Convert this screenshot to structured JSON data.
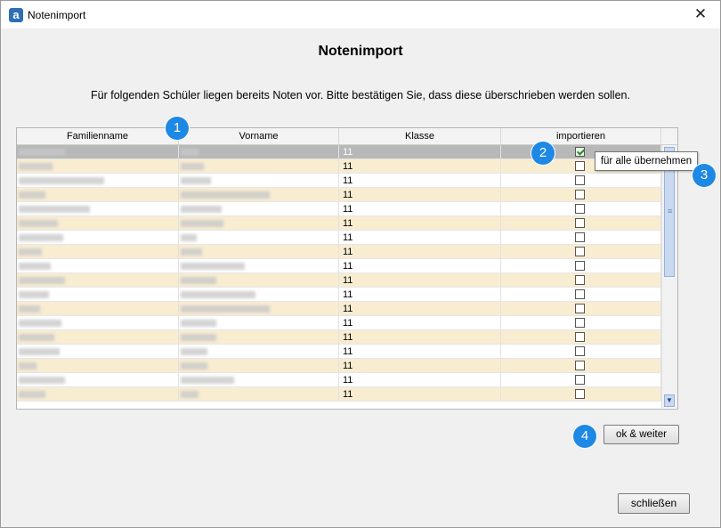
{
  "window": {
    "title": "Notenimport",
    "close_glyph": "✕",
    "app_logo": "a"
  },
  "dialog": {
    "heading": "Notenimport",
    "intro": "Für folgenden Schüler liegen bereits Noten vor. Bitte bestätigen Sie, dass diese überschrieben werden sollen."
  },
  "table": {
    "columns": [
      "Familienname",
      "Vorname",
      "Klasse",
      "importieren"
    ],
    "rows": [
      {
        "klasse": "11",
        "checked": true
      },
      {
        "klasse": "11",
        "checked": false
      },
      {
        "klasse": "11",
        "checked": false
      },
      {
        "klasse": "11",
        "checked": false
      },
      {
        "klasse": "11",
        "checked": false
      },
      {
        "klasse": "11",
        "checked": false
      },
      {
        "klasse": "11",
        "checked": false
      },
      {
        "klasse": "11",
        "checked": false
      },
      {
        "klasse": "11",
        "checked": false
      },
      {
        "klasse": "11",
        "checked": false
      },
      {
        "klasse": "11",
        "checked": false
      },
      {
        "klasse": "11",
        "checked": false
      },
      {
        "klasse": "11",
        "checked": false
      },
      {
        "klasse": "11",
        "checked": false
      },
      {
        "klasse": "11",
        "checked": false
      },
      {
        "klasse": "11",
        "checked": false
      },
      {
        "klasse": "11",
        "checked": false
      },
      {
        "klasse": "11",
        "checked": false
      }
    ]
  },
  "tooltip": "für alle übernehmen",
  "buttons": {
    "ok": "ok & weiter",
    "close": "schließen"
  },
  "badges": [
    "1",
    "2",
    "3",
    "4"
  ],
  "colors": {
    "badge": "#1e88e5",
    "row_alt": "#f8ecd1",
    "selected_row": "#b8b8b8",
    "check": "#2c8a2c"
  }
}
